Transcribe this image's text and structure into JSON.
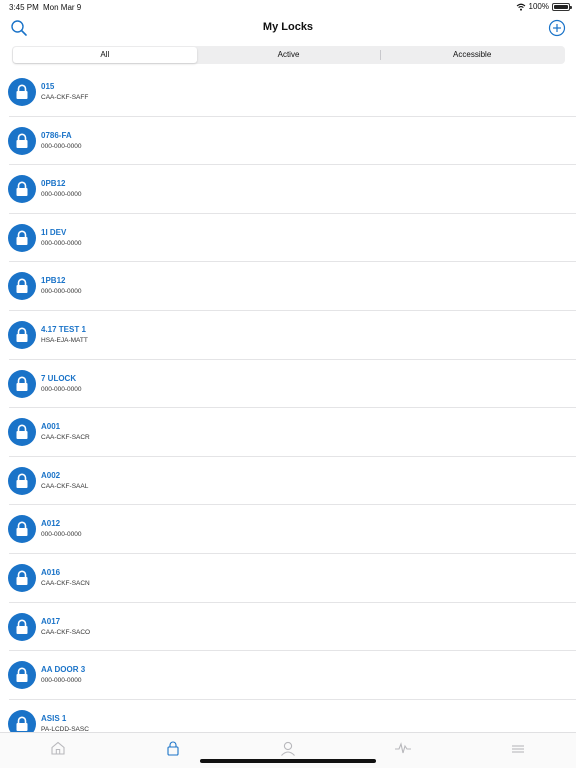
{
  "status_bar": {
    "time": "3:45 PM",
    "date": "Mon Mar 9",
    "battery": "100%"
  },
  "nav": {
    "title": "My Locks",
    "left_icon": "search-icon",
    "right_icon": "add-circle-icon"
  },
  "segments": [
    {
      "label": "All",
      "selected": true
    },
    {
      "label": "Active",
      "selected": false
    },
    {
      "label": "Accessible",
      "selected": false
    }
  ],
  "colors": {
    "accent": "#1a73c8",
    "tab_inactive": "#b8b8bc",
    "tab_active": "#1a73c8"
  },
  "locks": [
    {
      "name": "015",
      "code": "CAA-CKF-SAFF"
    },
    {
      "name": "0786-FA",
      "code": "000-000-0000"
    },
    {
      "name": "0PB12",
      "code": "000-000-0000"
    },
    {
      "name": "1I DEV",
      "code": "000-000-0000"
    },
    {
      "name": "1PB12",
      "code": "000-000-0000"
    },
    {
      "name": "4.17 TEST 1",
      "code": "HSA-EJA-MATT"
    },
    {
      "name": "7 ULOCK",
      "code": "000-000-0000"
    },
    {
      "name": "A001",
      "code": "CAA-CKF-SACR"
    },
    {
      "name": "A002",
      "code": "CAA-CKF-SAAL"
    },
    {
      "name": "A012",
      "code": "000-000-0000"
    },
    {
      "name": "A016",
      "code": "CAA-CKF-SACN"
    },
    {
      "name": "A017",
      "code": "CAA-CKF-SACO"
    },
    {
      "name": "AA DOOR 3",
      "code": "000-000-0000"
    },
    {
      "name": "ASIS 1",
      "code": "PA-LCDD-SASC"
    }
  ],
  "tabs": [
    {
      "icon": "home-icon",
      "active": false
    },
    {
      "icon": "lock-icon",
      "active": true
    },
    {
      "icon": "person-icon",
      "active": false
    },
    {
      "icon": "activity-icon",
      "active": false
    },
    {
      "icon": "menu-icon",
      "active": false
    }
  ]
}
